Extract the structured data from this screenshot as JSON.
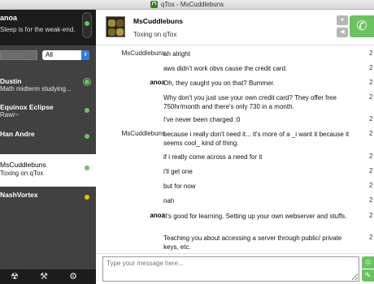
{
  "window": {
    "title": "qTox - MsCuddlebuns"
  },
  "self": {
    "name": "anoa",
    "status": "Sleep is for the weak-end."
  },
  "filter": {
    "search_placeholder": "contacts",
    "selected": "All"
  },
  "contacts": [
    {
      "name": "Dustin",
      "status": "Math midterm studying..."
    },
    {
      "name": "Equinox Eclipse",
      "status": "Rawr~"
    },
    {
      "name": "Han Andre",
      "status": ""
    },
    {
      "name": "MsCuddlebuns",
      "status": "Toxing on qTox"
    },
    {
      "name": "NashVortex",
      "status": ""
    }
  ],
  "chat": {
    "name": "MsCuddlebuns",
    "status": "Toxing on qTox",
    "messages": [
      {
        "author": "MsCuddlebuns",
        "text": "ah alright",
        "time": "2"
      },
      {
        "author": "",
        "text": "aws didn't work obvs cause the credit card.",
        "time": "2"
      },
      {
        "author": "anoa",
        "text": "Oh, they caught you on that? Bummer.",
        "time": "2"
      },
      {
        "author": "",
        "text": "Why don't you just use your own credit card? They offer free 750hr/month and there's only 730 in a month.",
        "time": "2"
      },
      {
        "author": "",
        "text": "I've never been charged :0",
        "time": "2"
      },
      {
        "author": "MsCuddlebuns",
        "text": "because i really don't need it... it's more of a _i want it because it seems cool_ kind of thing.",
        "time": "2"
      },
      {
        "author": "",
        "text": "if i really come across a need for it",
        "time": "2"
      },
      {
        "author": "",
        "text": "i'll get one",
        "time": "2"
      },
      {
        "author": "",
        "text": "but for now",
        "time": "2"
      },
      {
        "author": "",
        "text": "nah",
        "time": "2"
      },
      {
        "author": "anoa",
        "text": "It's good for learning. Setting up your own webserver and stuffs.",
        "time": "2"
      },
      {
        "author": "",
        "text": "Teaching you about accessing a server through public/ private keys, etc.",
        "time": "2"
      }
    ]
  },
  "input": {
    "placeholder": "Type your message here..."
  },
  "colors": {
    "accent_green": "#6bc260",
    "sidebar": "#414141",
    "away": "#e5c300"
  }
}
